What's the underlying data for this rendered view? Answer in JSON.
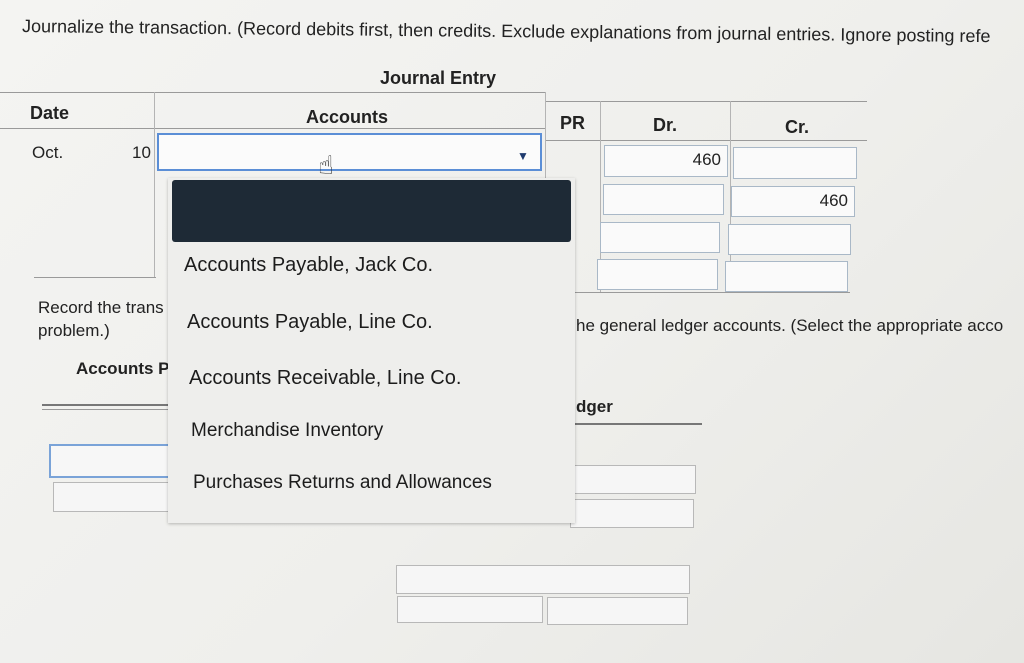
{
  "instructions": "Journalize the transaction. (Record debits first, then credits. Exclude explanations from journal entries. Ignore posting refe",
  "journal": {
    "title": "Journal Entry",
    "headers": {
      "date": "Date",
      "accounts": "Accounts",
      "pr": "PR",
      "dr": "Dr.",
      "cr": "Cr."
    },
    "row1": {
      "month": "Oct.",
      "day": "10",
      "account": "",
      "debit": "460",
      "credit": ""
    },
    "row2": {
      "debit": "",
      "credit": "460"
    }
  },
  "dropdown": {
    "options": [
      "",
      "Accounts Payable, Jack Co.",
      "Accounts Payable, Line Co.",
      "Accounts Receivable, Line Co.",
      "Merchandise Inventory",
      "Purchases Returns and Allowances"
    ]
  },
  "posting": {
    "text_left_1": "Record the trans",
    "text_left_2": "problem.)",
    "text_right": "he general ledger accounts. (Select the appropriate acco",
    "account_label": "Accounts P",
    "ledger_label": "dger"
  }
}
